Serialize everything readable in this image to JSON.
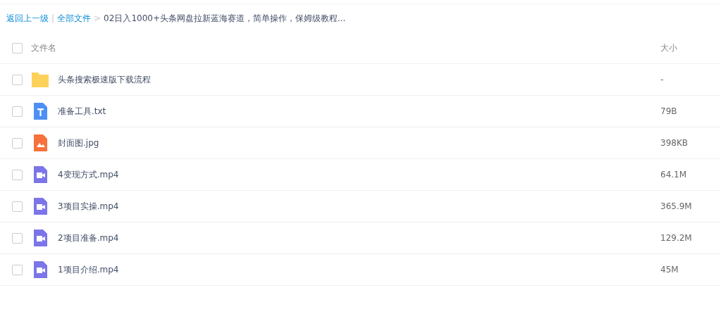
{
  "breadcrumb": {
    "back": "返回上一级",
    "divider": "|",
    "root": "全部文件",
    "arrow": ">",
    "current": "02日入1000+头条网盘拉新蓝海赛道，简单操作，保姆级教程..."
  },
  "table": {
    "header": {
      "checked": false,
      "name": "文件名",
      "size": "大小"
    },
    "rows": [
      {
        "kind": "folder",
        "name": "头条搜索极速版下载流程",
        "size": "-",
        "checked": false
      },
      {
        "kind": "text",
        "name": "准备工具.txt",
        "size": "79B",
        "checked": false
      },
      {
        "kind": "image",
        "name": "封面图.jpg",
        "size": "398KB",
        "checked": false
      },
      {
        "kind": "video",
        "name": "4变现方式.mp4",
        "size": "64.1M",
        "checked": false
      },
      {
        "kind": "video",
        "name": "3项目实操.mp4",
        "size": "365.9M",
        "checked": false
      },
      {
        "kind": "video",
        "name": "2项目准备.mp4",
        "size": "129.2M",
        "checked": false
      },
      {
        "kind": "video",
        "name": "1项目介绍.mp4",
        "size": "45M",
        "checked": false
      }
    ]
  }
}
